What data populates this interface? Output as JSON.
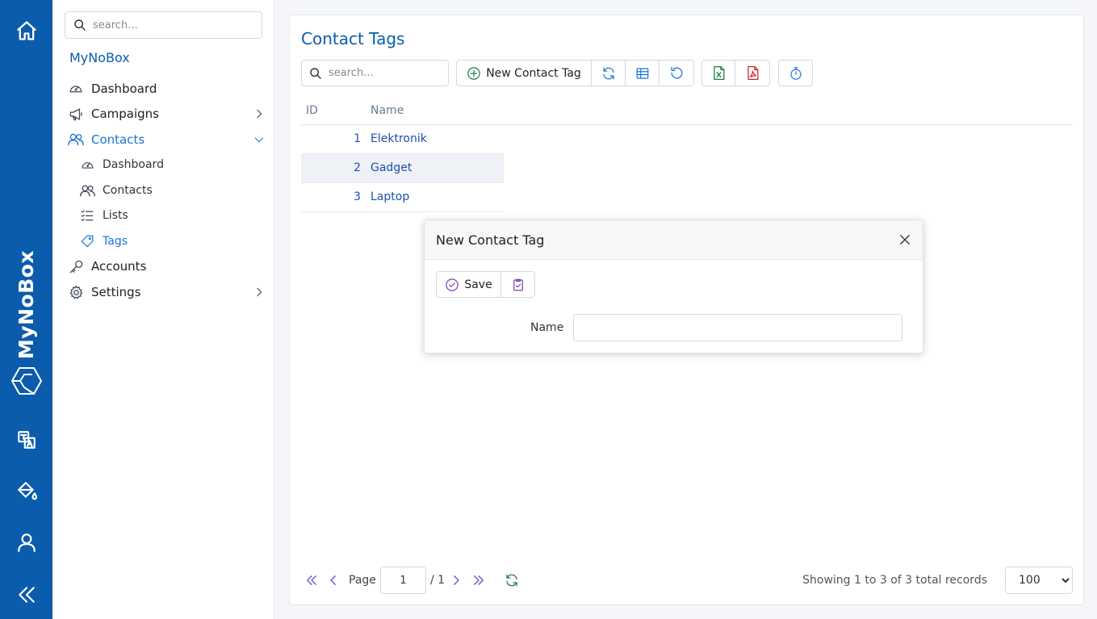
{
  "rail": {
    "brand": "MyNoBox",
    "icons": [
      "home-icon",
      "mynobox-logo-icon",
      "translate-icon",
      "paint-bucket-icon",
      "user-icon",
      "collapse-icon"
    ]
  },
  "sidebar": {
    "search_placeholder": "search...",
    "brand": "MyNoBox",
    "items": [
      {
        "label": "Dashboard",
        "icon": "dashboard-icon"
      },
      {
        "label": "Campaigns",
        "icon": "megaphone-icon",
        "expandable": true
      },
      {
        "label": "Contacts",
        "icon": "users-icon",
        "expanded": true,
        "active": true
      },
      {
        "label": "Accounts",
        "icon": "key-icon"
      },
      {
        "label": "Settings",
        "icon": "gear-icon",
        "expandable": true
      }
    ],
    "contacts_sub": [
      {
        "label": "Dashboard",
        "icon": "dashboard-icon"
      },
      {
        "label": "Contacts",
        "icon": "users-icon"
      },
      {
        "label": "Lists",
        "icon": "list-icon"
      },
      {
        "label": "Tags",
        "icon": "tag-icon",
        "active": true
      }
    ]
  },
  "main": {
    "title": "Contact Tags",
    "search_placeholder": "search...",
    "toolbar": {
      "new_label": "New Contact Tag"
    },
    "table": {
      "columns": [
        "ID",
        "Name"
      ],
      "rows": [
        {
          "id": "1",
          "name": "Elektronik"
        },
        {
          "id": "2",
          "name": "Gadget"
        },
        {
          "id": "3",
          "name": "Laptop"
        }
      ],
      "selected_row": 2
    },
    "pager": {
      "page_label": "Page",
      "page_value": "1",
      "total_pages": "/ 1",
      "records_text": "Showing 1 to 3 of 3 total records",
      "page_size": "100",
      "page_size_options": [
        "100"
      ]
    }
  },
  "dialog": {
    "title": "New Contact Tag",
    "save_label": "Save",
    "field_label": "Name",
    "field_value": ""
  },
  "colors": {
    "brand_blue": "#0b5cad",
    "link_blue": "#1a73d9",
    "excel_green": "#1e7b45",
    "pdf_red": "#c62828",
    "dialog_purple": "#7b3fb0"
  }
}
